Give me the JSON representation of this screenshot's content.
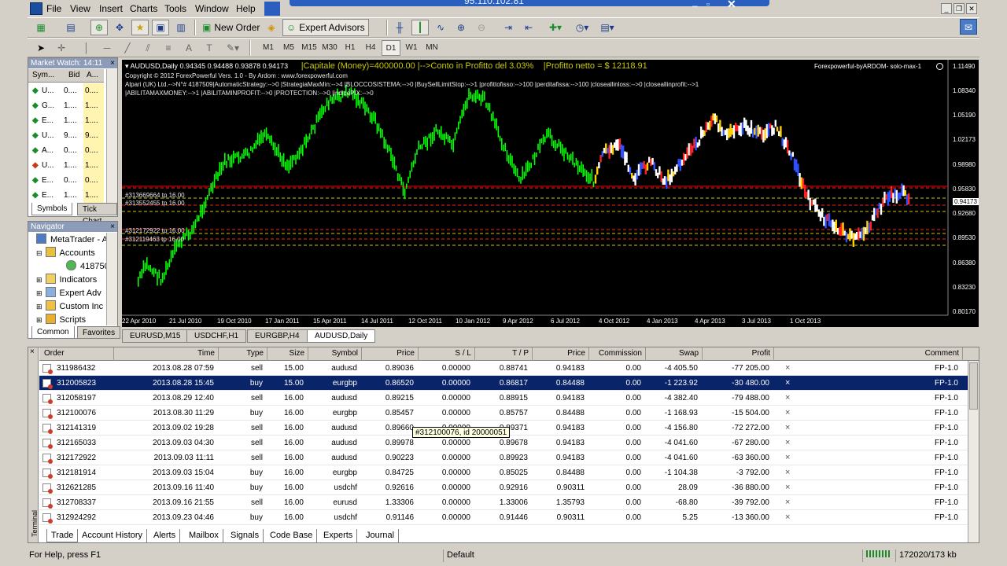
{
  "window": {
    "title": "95.110.102.81"
  },
  "menu": [
    "File",
    "View",
    "Insert",
    "Charts",
    "Tools",
    "Window",
    "Help"
  ],
  "toolbar": {
    "new_order": "New Order",
    "expert_advisors": "Expert Advisors",
    "timeframes": [
      "M1",
      "M5",
      "M15",
      "M30",
      "H1",
      "H4",
      "D1",
      "W1",
      "MN"
    ],
    "selected_timeframe": "D1"
  },
  "market_watch": {
    "title": "Market Watch: 14:11",
    "columns": [
      "Sym...",
      "Bid",
      "A..."
    ],
    "rows": [
      {
        "dir": "up",
        "sym": "U...",
        "bid": "0....",
        "ask": "0...."
      },
      {
        "dir": "up",
        "sym": "G...",
        "bid": "1....",
        "ask": "1...."
      },
      {
        "dir": "up",
        "sym": "E...",
        "bid": "1....",
        "ask": "1...."
      },
      {
        "dir": "up",
        "sym": "U...",
        "bid": "9....",
        "ask": "9...."
      },
      {
        "dir": "up",
        "sym": "A...",
        "bid": "0....",
        "ask": "0...."
      },
      {
        "dir": "down",
        "sym": "U...",
        "bid": "1....",
        "ask": "1...."
      },
      {
        "dir": "up",
        "sym": "E...",
        "bid": "0....",
        "ask": "0...."
      },
      {
        "dir": "up",
        "sym": "E...",
        "bid": "1....",
        "ask": "1...."
      }
    ],
    "tabs": [
      "Symbols",
      "Tick Chart"
    ]
  },
  "navigator": {
    "title": "Navigator",
    "items": [
      "MetaTrader - A",
      "Accounts",
      "418750",
      "Indicators",
      "Expert Adv",
      "Custom Inc",
      "Scripts"
    ],
    "tabs": [
      "Common",
      "Favorites"
    ]
  },
  "chart": {
    "header": "AUDUSD,Daily  0.94345 0.94488 0.93878 0.94173",
    "capitale": "|Capitale (Money)=400000.00 |-->Conto in Profitto del 3.03%",
    "profitto": "|Profitto netto = $ 12118.91",
    "brand": "Forexpowerful-byARDOM- solo-max-1",
    "line1": "Copyright © 2012 ForexPowerful Vers. 1.0 - By Ardom : www.forexpowerful.com",
    "line2": "Alpari (UK) Ltd.-->N°# 4187509|AutomaticStrategy:-->0 |StrategiaMaxMin:-->4 |BLOCCOSISTEMA:-->0 |BuySellLimitStop:-->1 |profittofisso:-->100 |perditafissa:-->100 |closeallinloss:-->0 |closeallinprofit:-->1",
    "line3": "|ABILITAMAXMONEY:-->1 |ABILITAMINPROFIT:-->0 |PROTECTION:-->0 |indicePIX:-->0",
    "order_labels": [
      "#313669664 tp 16.00",
      "#313552455 tp 16.00",
      "#312172922 tp 16.00",
      "#312119463 tp 16.00"
    ],
    "price_labels": [
      "1.11490",
      "1.08340",
      "1.05190",
      "1.02173",
      "0.98980",
      "0.95830",
      "0.94173",
      "0.92680",
      "0.89530",
      "0.86380",
      "0.83230",
      "0.80170"
    ],
    "date_labels": [
      "22 Apr 2010",
      "21 Jul 2010",
      "19 Oct 2010",
      "17 Jan 2011",
      "15 Apr 2011",
      "14 Jul 2011",
      "12 Oct 2011",
      "10 Jan 2012",
      "9 Apr 2012",
      "6 Jul 2012",
      "4 Oct 2012",
      "4 Jan 2013",
      "4 Apr 2013",
      "3 Jul 2013",
      "1 Oct 2013"
    ],
    "colors": {
      "bull": "#00ff00",
      "bg": "#000000",
      "order_line": "#ff0000"
    }
  },
  "chart_tabs": [
    "EURUSD,M15",
    "USDCHF,H1",
    "EURGBP,H4",
    "AUDUSD,Daily"
  ],
  "terminal": {
    "columns": [
      "Order",
      "Time",
      "Type",
      "Size",
      "Symbol",
      "Price",
      "S / L",
      "T / P",
      "Price",
      "Commission",
      "Swap",
      "Profit",
      "Comment"
    ],
    "rows": [
      {
        "order": "311986432",
        "time": "2013.08.28 07:59",
        "type": "sell",
        "size": "15.00",
        "symbol": "audusd",
        "price": "0.89036",
        "sl": "0.00000",
        "tp": "0.88741",
        "cur": "0.94183",
        "commission": "0.00",
        "swap": "-4 405.50",
        "profit": "-77 205.00",
        "comment": "FP-1.0"
      },
      {
        "order": "312005823",
        "time": "2013.08.28 15:45",
        "type": "buy",
        "size": "15.00",
        "symbol": "eurgbp",
        "price": "0.86520",
        "sl": "0.00000",
        "tp": "0.86817",
        "cur": "0.84488",
        "commission": "0.00",
        "swap": "-1 223.92",
        "profit": "-30 480.00",
        "comment": "FP-1.0"
      },
      {
        "order": "312058197",
        "time": "2013.08.29 12:40",
        "type": "sell",
        "size": "16.00",
        "symbol": "audusd",
        "price": "0.89215",
        "sl": "0.00000",
        "tp": "0.88915",
        "cur": "0.94183",
        "commission": "0.00",
        "swap": "-4 382.40",
        "profit": "-79 488.00",
        "comment": "FP-1.0"
      },
      {
        "order": "312100076",
        "time": "2013.08.30 11:29",
        "type": "buy",
        "size": "16.00",
        "symbol": "eurgbp",
        "price": "0.85457",
        "sl": "0.00000",
        "tp": "0.85757",
        "cur": "0.84488",
        "commission": "0.00",
        "swap": "-1 168.93",
        "profit": "-15 504.00",
        "comment": "FP-1.0"
      },
      {
        "order": "312141319",
        "time": "2013.09.02 19:28",
        "type": "sell",
        "size": "16.00",
        "symbol": "audusd",
        "price": "0.89660",
        "sl": "0.00000",
        "tp": "0.89371",
        "cur": "0.94183",
        "commission": "0.00",
        "swap": "-4 156.80",
        "profit": "-72 272.00",
        "comment": "FP-1.0"
      },
      {
        "order": "312165033",
        "time": "2013.09.03 04:30",
        "type": "sell",
        "size": "16.00",
        "symbol": "audusd",
        "price": "0.89978",
        "sl": "0.00000",
        "tp": "0.89678",
        "cur": "0.94183",
        "commission": "0.00",
        "swap": "-4 041.60",
        "profit": "-67 280.00",
        "comment": "FP-1.0"
      },
      {
        "order": "312172922",
        "time": "2013.09.03 11:11",
        "type": "sell",
        "size": "16.00",
        "symbol": "audusd",
        "price": "0.90223",
        "sl": "0.00000",
        "tp": "0.89923",
        "cur": "0.94183",
        "commission": "0.00",
        "swap": "-4 041.60",
        "profit": "-63 360.00",
        "comment": "FP-1.0"
      },
      {
        "order": "312181914",
        "time": "2013.09.03 15:04",
        "type": "buy",
        "size": "16.00",
        "symbol": "eurgbp",
        "price": "0.84725",
        "sl": "0.00000",
        "tp": "0.85025",
        "cur": "0.84488",
        "commission": "0.00",
        "swap": "-1 104.38",
        "profit": "-3 792.00",
        "comment": "FP-1.0"
      },
      {
        "order": "312621285",
        "time": "2013.09.16 11:40",
        "type": "buy",
        "size": "16.00",
        "symbol": "usdchf",
        "price": "0.92616",
        "sl": "0.00000",
        "tp": "0.92916",
        "cur": "0.90311",
        "commission": "0.00",
        "swap": "28.09",
        "profit": "-36 880.00",
        "comment": "FP-1.0"
      },
      {
        "order": "312708337",
        "time": "2013.09.16 21:55",
        "type": "sell",
        "size": "16.00",
        "symbol": "eurusd",
        "price": "1.33306",
        "sl": "0.00000",
        "tp": "1.33006",
        "cur": "1.35793",
        "commission": "0.00",
        "swap": "-68.80",
        "profit": "-39 792.00",
        "comment": "FP-1.0"
      },
      {
        "order": "312924292",
        "time": "2013.09.23 04:46",
        "type": "buy",
        "size": "16.00",
        "symbol": "usdchf",
        "price": "0.91146",
        "sl": "0.00000",
        "tp": "0.91446",
        "cur": "0.90311",
        "commission": "0.00",
        "swap": "5.25",
        "profit": "-13 360.00",
        "comment": "FP-1.0"
      }
    ],
    "selected_row": 1,
    "tooltip": "#312100076, id 20000051",
    "side_label": "Terminal",
    "tabs": [
      "Trade",
      "Account History",
      "Alerts",
      "Mailbox",
      "Signals",
      "Code Base",
      "Experts",
      "Journal"
    ]
  },
  "status": {
    "help": "For Help, press F1",
    "profile": "Default",
    "traffic": "172020/173 kb"
  }
}
